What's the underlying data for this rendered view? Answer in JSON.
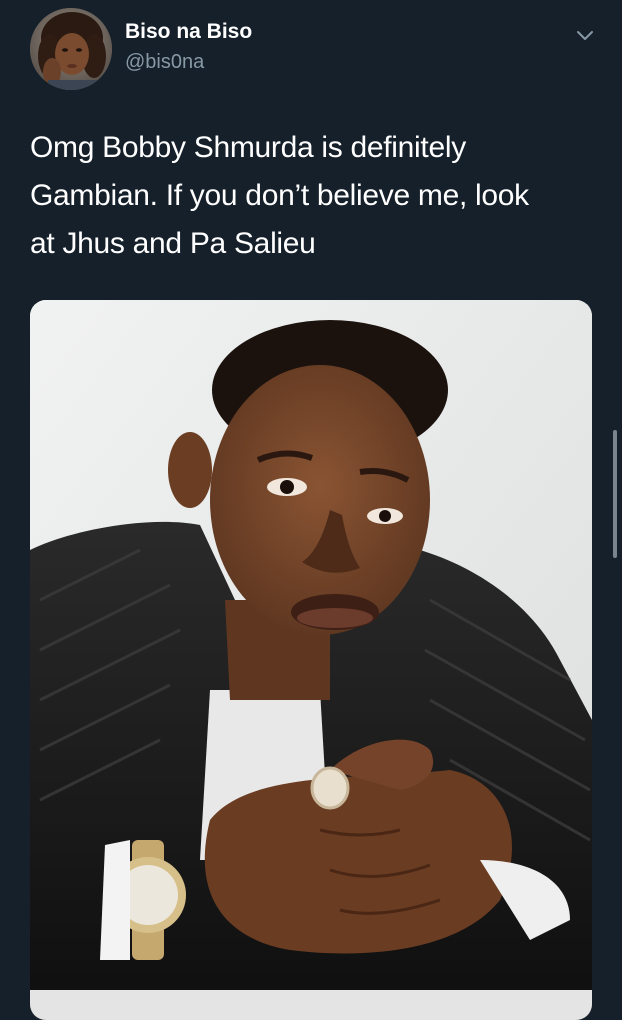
{
  "tweet": {
    "author": {
      "display_name": "Biso na Biso",
      "handle": "@bis0na"
    },
    "text_lines": [
      "Omg Bobby Shmurda is definitely",
      "Gambian. If you don’t believe me, look",
      "at Jhus and Pa Salieu"
    ],
    "menu_icon": "chevron-down-icon"
  },
  "colors": {
    "background": "#15202b",
    "text_primary": "#ffffff",
    "text_secondary": "#8899a6"
  }
}
